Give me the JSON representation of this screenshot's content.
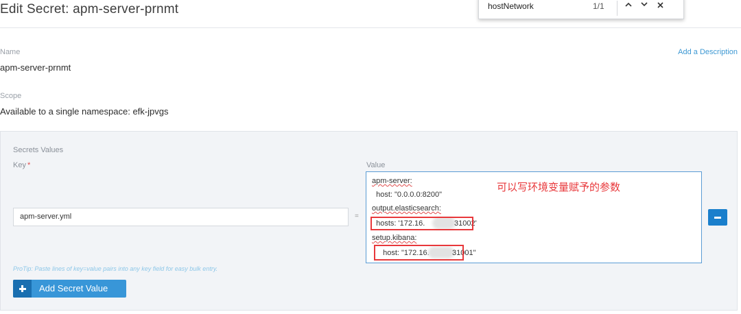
{
  "header": {
    "title": "Edit Secret: apm-server-prnmt"
  },
  "find_bar": {
    "query": "hostNetwork",
    "count": "1/1",
    "prev_icon": "chevron-up-icon",
    "next_icon": "chevron-down-icon",
    "close_icon": "close-icon"
  },
  "name": {
    "label": "Name",
    "value": "apm-server-prnmt",
    "add_description": "Add a Description"
  },
  "scope": {
    "label": "Scope",
    "value": "Available to a single namespace: efk-jpvgs"
  },
  "secrets": {
    "section_title": "Secrets Values",
    "key_label": "Key",
    "required_mark": "*",
    "value_label": "Value",
    "rows": [
      {
        "key": "apm-server.yml",
        "equals": "=",
        "value_lines": [
          "apm-server:",
          "  host: \"0.0.0.0:8200\"",
          "output.elasticsearch:",
          "  hosts: '172.16.",
          "31002'",
          "setup.kibana:",
          "  host: \"172.16.",
          "31001\""
        ]
      }
    ],
    "annotation": "可以写环境变量赋予的参数",
    "protip": "ProTip: Paste lines of key=value pairs into any key field for easy bulk entry.",
    "add_button_label": "Add Secret Value"
  },
  "colors": {
    "accent": "#3896d8",
    "accent_dark": "#1a6fb0",
    "annotation_red": "#e8373a",
    "panel_bg": "#f2f4f7"
  }
}
